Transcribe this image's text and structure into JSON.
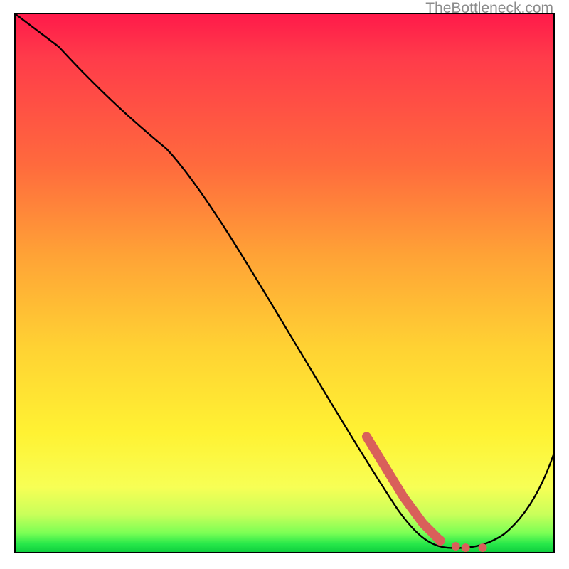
{
  "attribution": "TheBottleneck.com",
  "chart_data": {
    "type": "line",
    "title": "",
    "xlabel": "",
    "ylabel": "",
    "xlim": [
      0,
      100
    ],
    "ylim": [
      0,
      100
    ],
    "series": [
      {
        "name": "main-curve",
        "x": [
          0,
          8,
          22,
          28,
          68,
          76,
          82,
          88,
          92,
          100
        ],
        "values": [
          100,
          94,
          80,
          75,
          16,
          4,
          1,
          1,
          3,
          18
        ]
      },
      {
        "name": "highlight-segment",
        "x": [
          65,
          68,
          71,
          74,
          77,
          79,
          82,
          84,
          86
        ],
        "values": [
          21,
          16,
          11,
          7,
          4,
          2,
          1,
          1,
          1
        ]
      }
    ],
    "gradient_stops": [
      {
        "pos": 0.0,
        "color": "#ff1a4a"
      },
      {
        "pos": 0.28,
        "color": "#ff6a3d"
      },
      {
        "pos": 0.62,
        "color": "#ffd233"
      },
      {
        "pos": 0.88,
        "color": "#f7ff55"
      },
      {
        "pos": 1.0,
        "color": "#0fcf3f"
      }
    ]
  }
}
